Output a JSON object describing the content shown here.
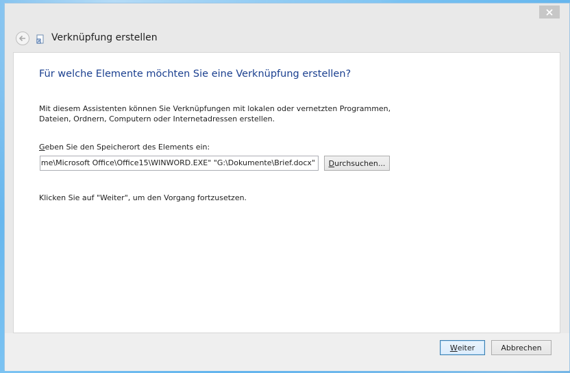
{
  "window": {
    "title": "Verknüpfung erstellen"
  },
  "main": {
    "heading": "Für welche Elemente möchten Sie eine Verknüpfung erstellen?",
    "description": "Mit diesem Assistenten können Sie Verknüpfungen mit lokalen oder vernetzten Programmen, Dateien, Ordnern, Computern oder Internetadressen erstellen.",
    "location_label_accel": "G",
    "location_label_rest": "eben Sie den Speicherort des Elements ein:",
    "location_value": "me\\Microsoft Office\\Office15\\WINWORD.EXE\" \"G:\\Dokumente\\Brief.docx\"",
    "browse_accel": "D",
    "browse_rest": "urchsuchen...",
    "continue_hint": "Klicken Sie auf \"Weiter\", um den Vorgang fortzusetzen."
  },
  "footer": {
    "next_accel": "W",
    "next_rest": "eiter",
    "cancel_label": "Abbrechen"
  },
  "icons": {
    "close": "close-icon",
    "back": "back-arrow-icon",
    "app": "shortcut-icon"
  },
  "colors": {
    "heading": "#1a3f8f",
    "desktop": "#4aa6e8",
    "next_border": "#3c7fb1"
  }
}
